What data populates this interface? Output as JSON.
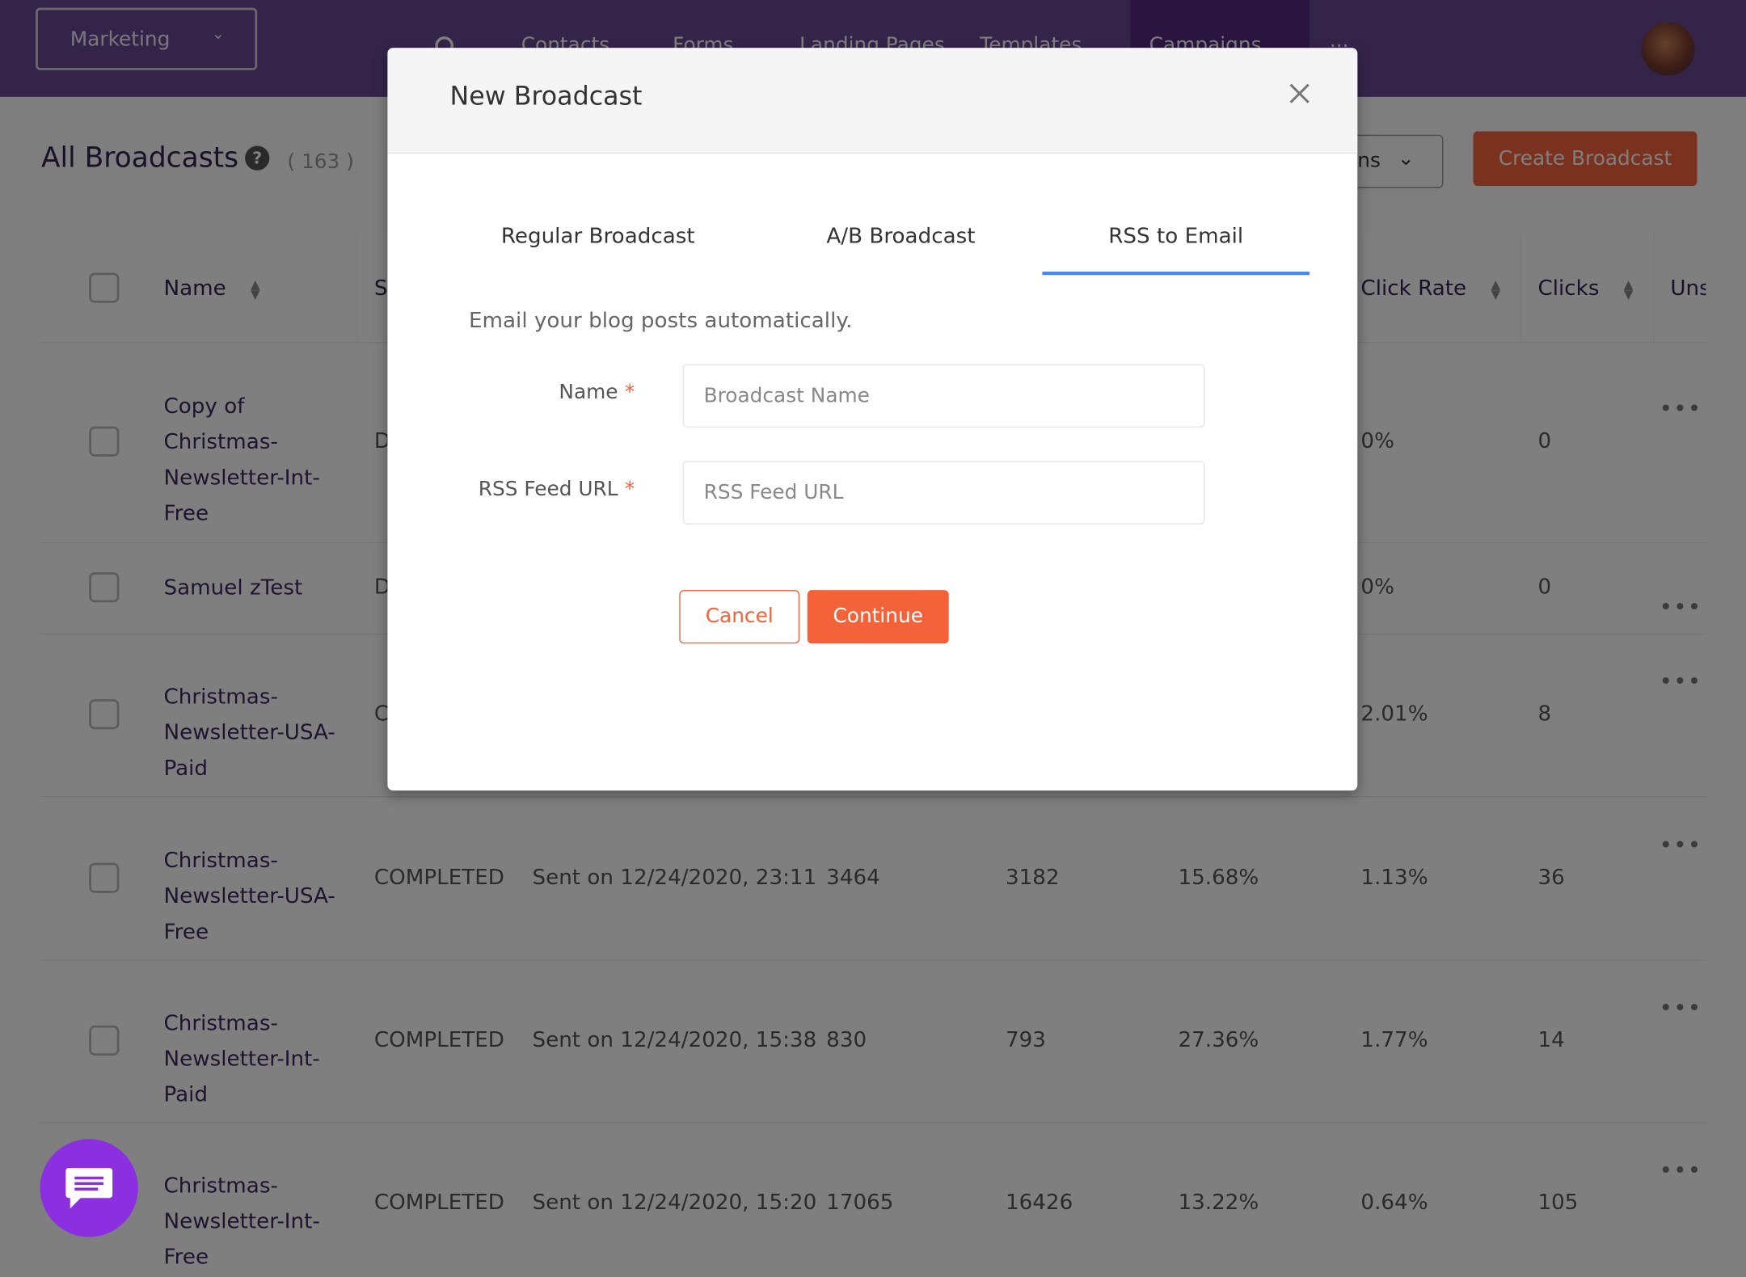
{
  "nav": {
    "workspace": "Marketing",
    "items": [
      "Contacts",
      "Forms",
      "Landing Pages",
      "Templates",
      "Campaigns"
    ],
    "active": "Campaigns",
    "more": "..."
  },
  "page": {
    "title": "All Broadcasts",
    "count": "( 163 )",
    "actions_label": "ns",
    "create_label": "Create Broadcast"
  },
  "table": {
    "headers": {
      "name": "Name",
      "status": "S",
      "click_rate": "Click Rate",
      "clicks": "Clicks",
      "unsub": "Uns"
    },
    "rows": [
      {
        "name": "Copy of Christmas-Newsletter-Int-Free",
        "status": "D",
        "sent": "",
        "recipients": "",
        "delivered": "",
        "open_rate": "",
        "click_rate": "0%",
        "clicks": "0"
      },
      {
        "name": "Samuel zTest",
        "status": "D",
        "sent": "",
        "recipients": "",
        "delivered": "",
        "open_rate": "",
        "click_rate": "0%",
        "clicks": "0"
      },
      {
        "name": "Christmas-Newsletter-USA-Paid",
        "status": "C",
        "sent": "",
        "recipients": "",
        "delivered": "",
        "open_rate": "",
        "click_rate": "2.01%",
        "clicks": "8"
      },
      {
        "name": "Christmas-Newsletter-USA-Free",
        "status": "COMPLETED",
        "sent": "Sent on 12/24/2020, 23:11",
        "recipients": "3464",
        "delivered": "3182",
        "open_rate": "15.68%",
        "click_rate": "1.13%",
        "clicks": "36"
      },
      {
        "name": "Christmas-Newsletter-Int-Paid",
        "status": "COMPLETED",
        "sent": "Sent on 12/24/2020, 15:38",
        "recipients": "830",
        "delivered": "793",
        "open_rate": "27.36%",
        "click_rate": "1.77%",
        "clicks": "14"
      },
      {
        "name": "Christmas-Newsletter-Int-Free",
        "status": "COMPLETED",
        "sent": "Sent on 12/24/2020, 15:20",
        "recipients": "17065",
        "delivered": "16426",
        "open_rate": "13.22%",
        "click_rate": "0.64%",
        "clicks": "105"
      }
    ]
  },
  "modal": {
    "title": "New Broadcast",
    "tabs": [
      "Regular Broadcast",
      "A/B Broadcast",
      "RSS to Email"
    ],
    "active_tab": "RSS to Email",
    "description": "Email your blog posts automatically.",
    "fields": [
      {
        "label": "Name",
        "required_mark": "*",
        "placeholder": "Broadcast Name",
        "value": ""
      },
      {
        "label": "RSS Feed URL",
        "required_mark": "*",
        "placeholder": "RSS Feed URL",
        "value": ""
      }
    ],
    "cancel_label": "Cancel",
    "continue_label": "Continue"
  },
  "colors": {
    "nav": "#6a4894",
    "accent": "#f4623a",
    "tab_active": "#4285f4",
    "chat": "#8b2fe0"
  },
  "icons": {
    "search": "search-icon",
    "close": "close-icon",
    "chat": "chat-icon",
    "help": "help-icon",
    "more": "more-dots-icon"
  }
}
